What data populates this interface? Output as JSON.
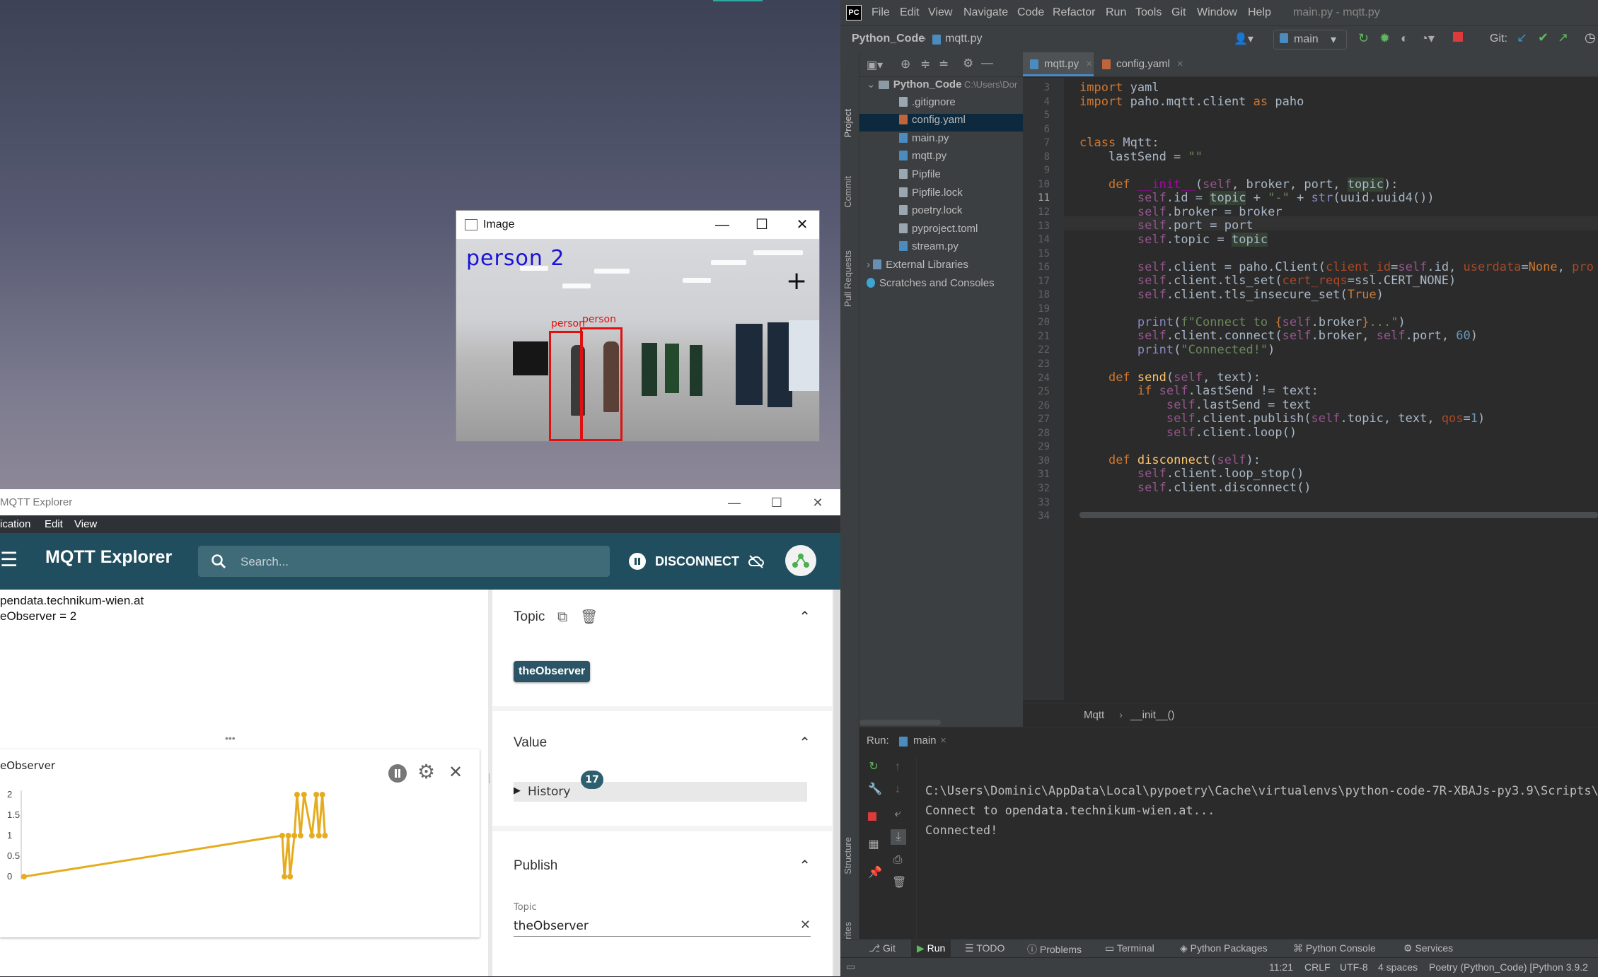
{
  "image_window": {
    "title": "Image",
    "detection_label": "person  2",
    "bbox_labels": [
      "person",
      "person"
    ]
  },
  "mqtt": {
    "window_title": "MQTT Explorer",
    "menu": [
      "ication",
      "Edit",
      "View"
    ],
    "app_title": "MQTT Explorer",
    "search_placeholder": "Search...",
    "disconnect_label": "DISCONNECT",
    "tree_lines": [
      "pendata.technikum-wien.at",
      "eObserver = 2"
    ],
    "chart_title": "eObserver",
    "topic_section": {
      "title": "Topic",
      "chip": "theObserver"
    },
    "value_section": {
      "title": "Value",
      "history_label": "History",
      "history_count": "17"
    },
    "publish_section": {
      "title": "Publish",
      "topic_label": "Topic",
      "topic_value": "theObserver"
    }
  },
  "chart_data": {
    "type": "line",
    "title": "eObserver",
    "xlabel": "",
    "ylabel": "",
    "ylim": [
      0,
      2
    ],
    "yticks": [
      "2",
      "1.5",
      "1",
      "0.5",
      "0"
    ],
    "series": [
      {
        "values": [
          0,
          1,
          0,
          1,
          0,
          1,
          2,
          1,
          2,
          1,
          2,
          1,
          2,
          1
        ]
      }
    ],
    "color": "#e6ac1f"
  },
  "ide": {
    "menu": [
      "File",
      "Edit",
      "View",
      "Navigate",
      "Code",
      "Refactor",
      "Run",
      "Tools",
      "Git",
      "Window",
      "Help"
    ],
    "window_title": "main.py - mqtt.py",
    "breadcrumb": [
      "Python_Code",
      "mqtt.py"
    ],
    "branch": "main",
    "git_label": "Git:",
    "side_tabs": [
      "Project",
      "Commit",
      "Pull Requests",
      "Structure",
      "Favorites"
    ],
    "project_tree": [
      {
        "label": "Python_Code",
        "extra": "C:\\Users\\Dor",
        "kind": "root"
      },
      {
        "label": ".gitignore",
        "kind": "file"
      },
      {
        "label": "config.yaml",
        "kind": "yml",
        "selected": true
      },
      {
        "label": "main.py",
        "kind": "py"
      },
      {
        "label": "mqtt.py",
        "kind": "py"
      },
      {
        "label": "Pipfile",
        "kind": "file"
      },
      {
        "label": "Pipfile.lock",
        "kind": "file"
      },
      {
        "label": "poetry.lock",
        "kind": "file"
      },
      {
        "label": "pyproject.toml",
        "kind": "file"
      },
      {
        "label": "stream.py",
        "kind": "py"
      },
      {
        "label": "External Libraries",
        "kind": "lib"
      },
      {
        "label": "Scratches and Consoles",
        "kind": "scratch"
      }
    ],
    "tabs": [
      "mqtt.py",
      "config.yaml"
    ],
    "line_numbers": [
      "3",
      "4",
      "5",
      "6",
      "7",
      "8",
      "9",
      "10",
      "11",
      "12",
      "13",
      "14",
      "15",
      "16",
      "17",
      "18",
      "19",
      "20",
      "21",
      "22",
      "23",
      "24",
      "25",
      "26",
      "27",
      "28",
      "29",
      "30",
      "31",
      "32",
      "33",
      "34"
    ],
    "editor_breadcrumb": [
      "Mqtt",
      "__init__()"
    ],
    "run_label": "Run:",
    "run_config": "main",
    "console": [
      "C:\\Users\\Dominic\\AppData\\Local\\pypoetry\\Cache\\virtualenvs\\python-code-7R-XBAJs-py3.9\\Scripts\\",
      "Connect to opendata.technikum-wien.at...",
      "Connected!"
    ],
    "bottom_tools": [
      "Git",
      "Run",
      "TODO",
      "Problems",
      "Terminal",
      "Python Packages",
      "Python Console",
      "Services"
    ],
    "status": [
      "11:21",
      "CRLF",
      "UTF-8",
      "4 spaces",
      "Poetry (Python_Code) [Python 3.9.2"
    ]
  }
}
